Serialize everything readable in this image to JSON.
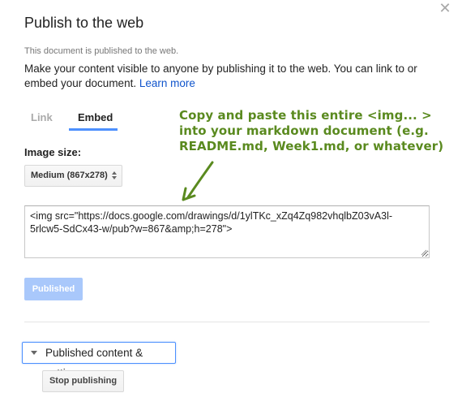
{
  "dialog": {
    "title": "Publish to the web",
    "close_icon": "close-icon",
    "published_note": "This document is published to the web.",
    "description": "Make your content visible to anyone by publishing it to the web. You can link to or embed your document.",
    "learn_more": "Learn more"
  },
  "tabs": [
    {
      "label": "Link",
      "active": false
    },
    {
      "label": "Embed",
      "active": true
    }
  ],
  "annotation": {
    "text": "Copy and paste this entire <img... > into your markdown document (e.g. README.md, Week1.md, or whatever)",
    "color": "#5a8a1f"
  },
  "image_size": {
    "label": "Image size:",
    "selected": "Medium (867x278)"
  },
  "embed_code": "<img src=\"https://docs.google.com/drawings/d/1ylTKc_xZq4Zq982vhqlbZ03vA3l-5rlcw5-SdCx43-w/pub?w=867&amp;h=278\">",
  "buttons": {
    "published": "Published",
    "stop_publishing": "Stop publishing"
  },
  "settings": {
    "label": "Published content & settings"
  },
  "colors": {
    "accent": "#4d90fe",
    "link": "#1155cc",
    "published_button": "#a9c8fb"
  }
}
